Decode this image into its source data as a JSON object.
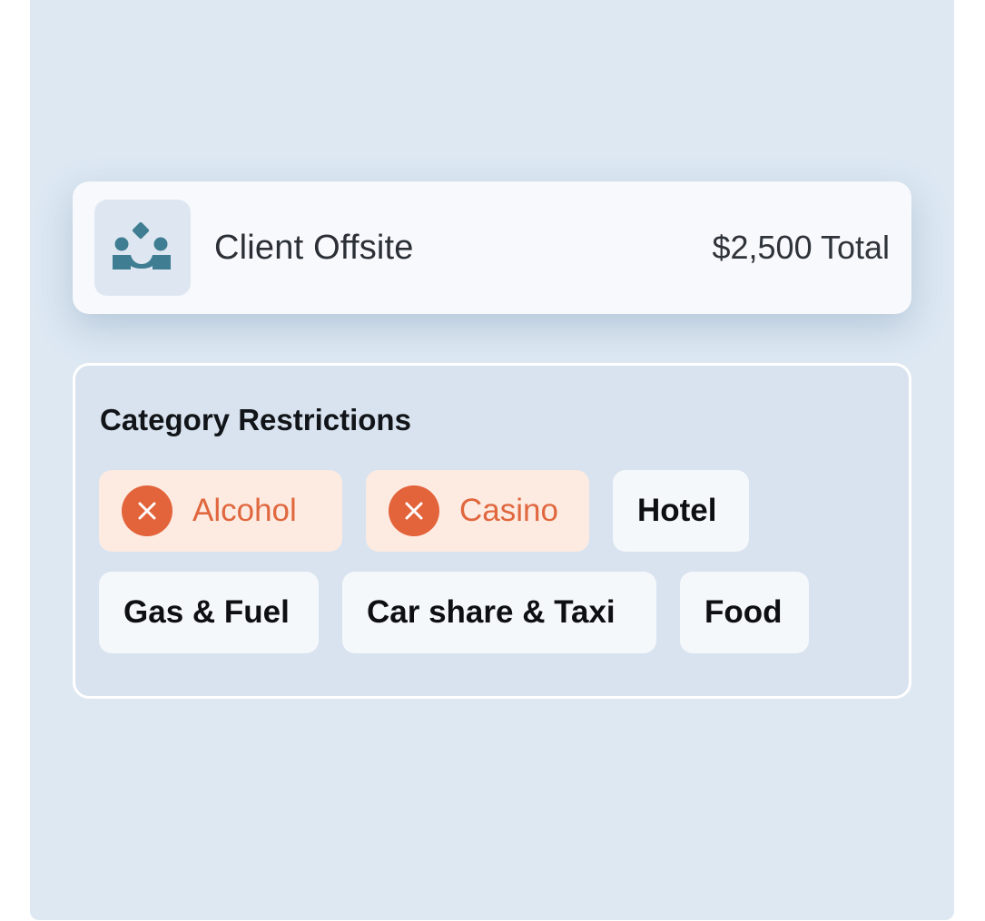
{
  "budget": {
    "icon": "team-icon",
    "title": "Client Offsite",
    "total": "$2,500 Total",
    "accent_color": "#3f7d92"
  },
  "restrictions": {
    "title": "Category Restrictions",
    "blocked_color": "#e3633a",
    "blocked": [
      {
        "label": "Alcohol",
        "icon": "close-circle-icon"
      },
      {
        "label": "Casino",
        "icon": "close-circle-icon"
      }
    ],
    "allowed": [
      {
        "label": "Hotel"
      },
      {
        "label": "Gas & Fuel"
      },
      {
        "label": "Car share & Taxi"
      },
      {
        "label": "Food"
      }
    ]
  }
}
